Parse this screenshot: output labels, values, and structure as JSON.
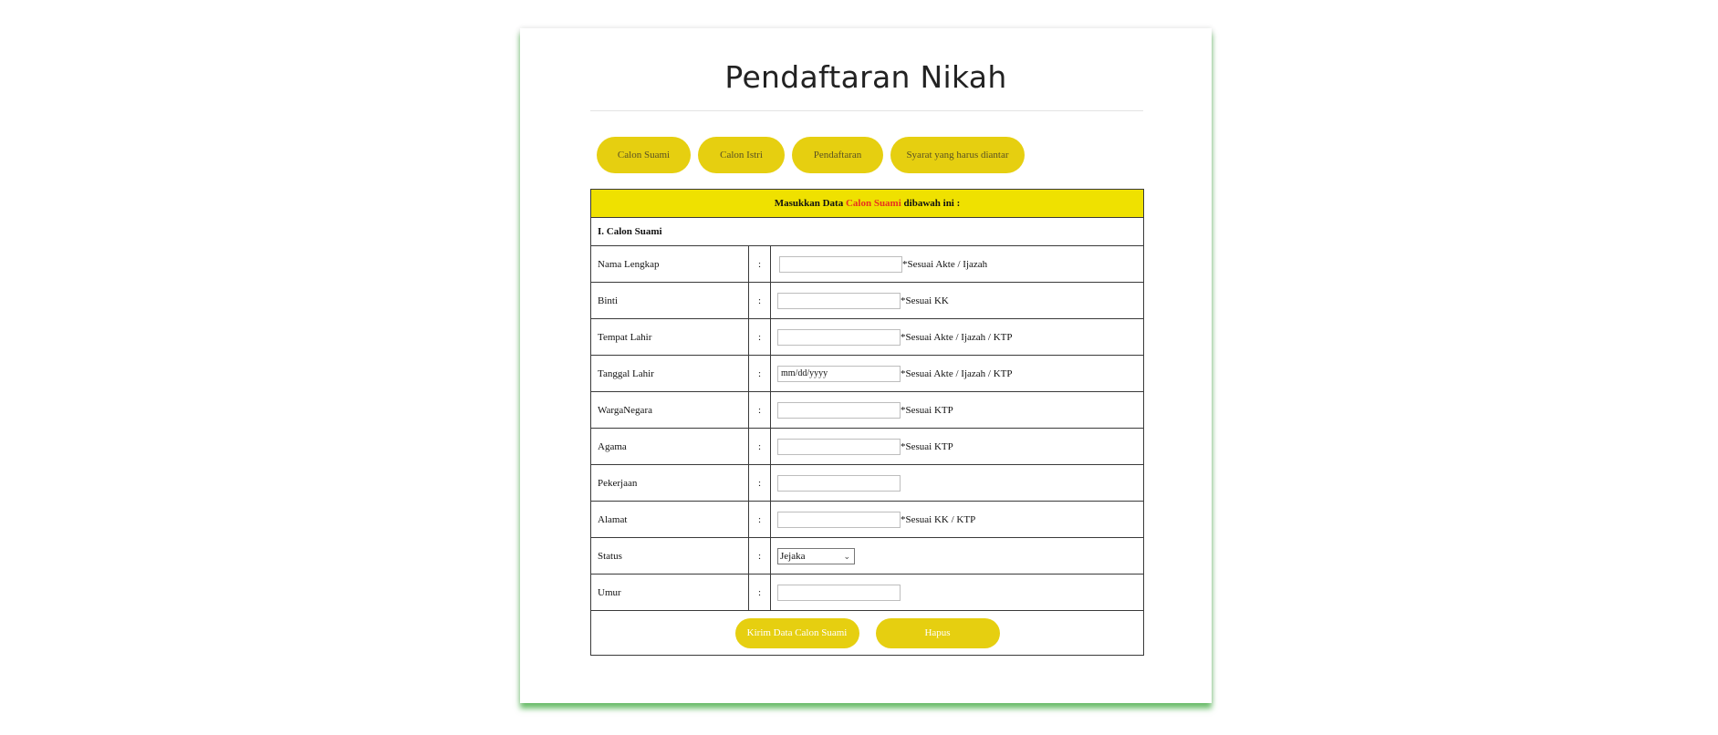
{
  "page": {
    "title": "Pendaftaran Nikah"
  },
  "nav": {
    "calon_suami": "Calon Suami",
    "calon_istri": "Calon Istri",
    "pendaftaran": "Pendaftaran",
    "syarat": "Syarat yang harus diantar"
  },
  "form": {
    "header_prefix": "Masukkan Data ",
    "header_highlight": "Calon Suami",
    "header_suffix": " dibawah ini :",
    "section": "I. Calon Suami",
    "colon": ":",
    "rows": [
      {
        "label": "Nama Lengkap",
        "value": "",
        "note": "*Sesuai Akte / Ijazah"
      },
      {
        "label": "Binti",
        "value": "",
        "note": "*Sesuai KK"
      },
      {
        "label": "Tempat Lahir",
        "value": "",
        "note": "*Sesuai Akte / Ijazah / KTP"
      },
      {
        "label": "Tanggal Lahir",
        "value": "mm/dd/yyyy",
        "note": "*Sesuai Akte / Ijazah / KTP"
      },
      {
        "label": "WargaNegara",
        "value": "",
        "note": "*Sesuai KTP"
      },
      {
        "label": "Agama",
        "value": "",
        "note": "*Sesuai KTP"
      },
      {
        "label": "Pekerjaan",
        "value": "",
        "note": ""
      },
      {
        "label": "Alamat",
        "value": "",
        "note": "*Sesuai KK / KTP"
      },
      {
        "label": "Status",
        "selected": "Jejaka"
      },
      {
        "label": "Umur",
        "value": ""
      }
    ],
    "submit_label": "Kirim Data Calon Suami",
    "reset_label": "Hapus"
  },
  "colors": {
    "accent": "#e6cf10",
    "header_bg": "#efe100",
    "highlight": "#e8321e",
    "shadow": "#3caa3c"
  },
  "icons": {
    "select": "chevron-down-icon"
  }
}
